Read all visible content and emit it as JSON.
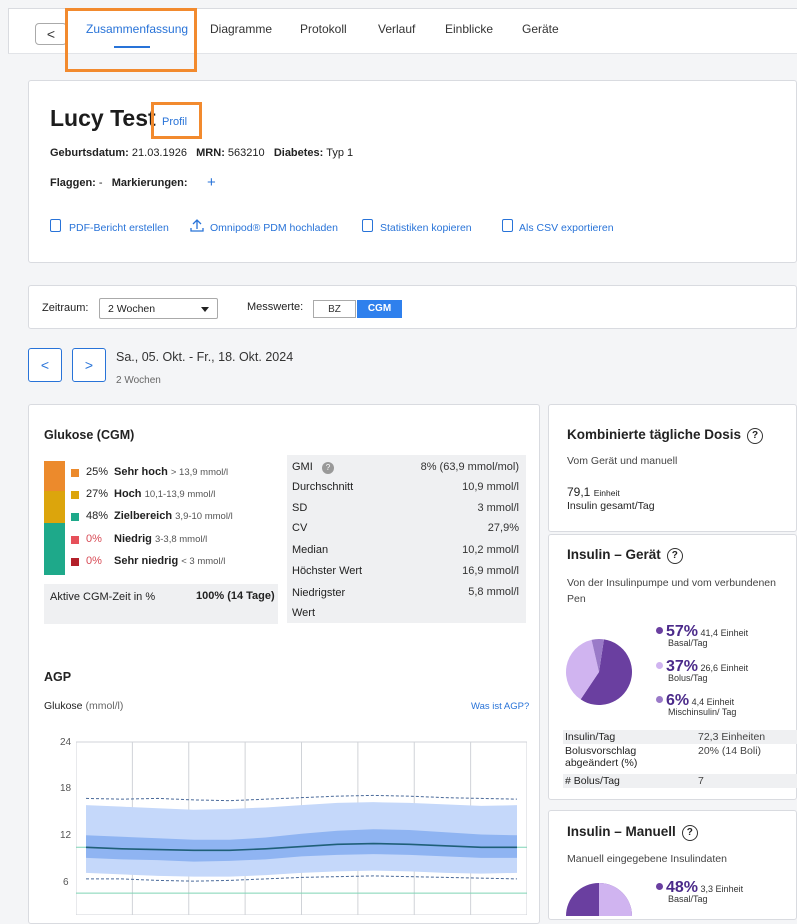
{
  "tabs": {
    "back": "<",
    "items": [
      "Zusammenfassung",
      "Diagramme",
      "Protokoll",
      "Verlauf",
      "Einblicke",
      "Geräte"
    ]
  },
  "patient": {
    "name": "Lucy Test",
    "profile_link": "Profil",
    "birth_label": "Geburtsdatum:",
    "birth_value": "21.03.1926",
    "mrn_label": "MRN:",
    "mrn_value": "563210",
    "diabetes_label": "Diabetes:",
    "diabetes_value": "Typ 1",
    "flags_label": "Flaggen:",
    "flags_value": "-",
    "marks_label": "Markierungen:",
    "add": "+"
  },
  "actions": [
    "PDF-Bericht erstellen",
    "Omnipod® PDM hochladen",
    "Statistiken kopieren",
    "Als CSV exportieren"
  ],
  "filters": {
    "period_label": "Zeitraum:",
    "period_value": "2 Wochen",
    "values_label": "Messwerte:",
    "bz": "BZ",
    "cgm": "CGM"
  },
  "daterange": {
    "prev": "<",
    "next": ">",
    "range": "Sa., 05. Okt. - Fr., 18. Okt. 2024",
    "span": "2 Wochen"
  },
  "glucose": {
    "title": "Glukose (CGM)",
    "ranges": [
      {
        "pct": "25%",
        "label": "Sehr hoch",
        "range": "> 13,9 mmol/l",
        "color": "#ec8a2c",
        "value": 25
      },
      {
        "pct": "27%",
        "label": "Hoch",
        "range": "10,1-13,9 mmol/l",
        "color": "#dca50c",
        "value": 27
      },
      {
        "pct": "48%",
        "label": "Zielbereich",
        "range": "3,9-10 mmol/l",
        "color": "#1ea98a",
        "value": 48
      },
      {
        "pct": "0%",
        "label": "Niedrig",
        "range": "3-3,8 mmol/l",
        "color": "#e6505a",
        "value": 0
      },
      {
        "pct": "0%",
        "label": "Sehr niedrig",
        "range": "< 3 mmol/l",
        "color": "#b3202a",
        "value": 0
      }
    ],
    "active_label": "Aktive CGM-Zeit in %",
    "active_value": "100% (14 Tage)",
    "stats": [
      {
        "label": "GMI",
        "value": "8% (63,9 mmol/mol)"
      },
      {
        "label": "Durchschnitt",
        "value": "10,9 mmol/l"
      },
      {
        "label": "SD",
        "value": "3 mmol/l"
      },
      {
        "label": "CV",
        "value": "27,9%"
      },
      {
        "label": "Median",
        "value": "10,2 mmol/l"
      },
      {
        "label": "Höchster Wert",
        "value": "16,9 mmol/l"
      },
      {
        "label": "Niedrigster Wert",
        "value": "5,8 mmol/l"
      }
    ]
  },
  "agp": {
    "title": "AGP",
    "axis_label": "Glukose",
    "axis_unit": "(mmol/l)",
    "help_link": "Was ist AGP?",
    "yticks": [
      "24",
      "18",
      "12",
      "6"
    ]
  },
  "chart_data": {
    "type": "area",
    "title": "AGP",
    "ylabel": "Glukose (mmol/l)",
    "ylim": [
      0,
      24
    ],
    "yticks": [
      6,
      12,
      18,
      24
    ],
    "x": [
      0,
      2,
      4,
      6,
      8,
      10,
      12,
      14,
      16,
      18,
      20,
      22,
      24
    ],
    "series": [
      {
        "values": [
          16.5,
          16.4,
          16.5,
          16.3,
          16.2,
          16.4,
          16.6,
          16.8,
          16.9,
          16.8,
          16.6,
          16.5,
          16.4
        ]
      },
      {
        "values": [
          15.6,
          15.4,
          15.2,
          15.0,
          15.1,
          15.3,
          15.6,
          15.9,
          16.0,
          15.9,
          15.7,
          15.5,
          15.6
        ]
      },
      {
        "values": [
          11.6,
          11.4,
          11.2,
          11.0,
          11.0,
          11.3,
          11.8,
          12.2,
          12.4,
          12.3,
          12.0,
          11.7,
          11.6
        ]
      },
      {
        "values": [
          10.0,
          9.8,
          9.7,
          9.6,
          9.6,
          9.8,
          10.1,
          10.4,
          10.5,
          10.4,
          10.2,
          10.0,
          10.0
        ]
      },
      {
        "values": [
          8.6,
          8.4,
          8.3,
          8.1,
          8.2,
          8.4,
          8.8,
          9.0,
          9.1,
          9.0,
          8.8,
          8.6,
          8.6
        ]
      },
      {
        "values": [
          6.6,
          6.4,
          6.2,
          6.1,
          6.1,
          6.3,
          6.6,
          6.8,
          6.9,
          6.8,
          6.6,
          6.5,
          6.6
        ]
      },
      {
        "values": [
          5.8,
          5.8,
          5.6,
          5.5,
          5.6,
          5.8,
          6.0,
          6.1,
          6.2,
          6.1,
          6.0,
          5.9,
          5.8
        ]
      }
    ],
    "target_range": [
      3.9,
      10
    ]
  },
  "daily_dose": {
    "title": "Kombinierte tägliche Dosis",
    "sub": "Vom Gerät und manuell",
    "value": "79,1",
    "unit": "Einheit",
    "label": "Insulin gesamt/Tag"
  },
  "device": {
    "title": "Insulin – Gerät",
    "sub": "Von der Insulinpumpe und vom verbundenen Pen",
    "slices": [
      {
        "pct": "57%",
        "units": "41,4 Einheit",
        "label": "Basal/Tag",
        "color": "#6a3fa0",
        "value": 57
      },
      {
        "pct": "37%",
        "units": "26,6 Einheit",
        "label": "Bolus/Tag",
        "color": "#d0b4f0",
        "value": 37
      },
      {
        "pct": "6%",
        "units": "4,4 Einheit",
        "label": "Mischinsulin/ Tag",
        "color": "#9a7ac8",
        "value": 6
      }
    ],
    "rows": [
      {
        "label": "Insulin/Tag",
        "value": "72,3 Einheiten"
      },
      {
        "label": "Bolusvorschlag abgeändert (%)",
        "value": "20% (14 Boli)"
      },
      {
        "label": "# Bolus/Tag",
        "value": "7"
      }
    ]
  },
  "manual": {
    "title": "Insulin – Manuell",
    "sub": "Manuell eingegebene Insulindaten",
    "slice_pct": "48%",
    "slice_units": "3,3 Einheit",
    "slice_label": "Basal/Tag",
    "slice_value": 48
  },
  "help_icon": "?"
}
